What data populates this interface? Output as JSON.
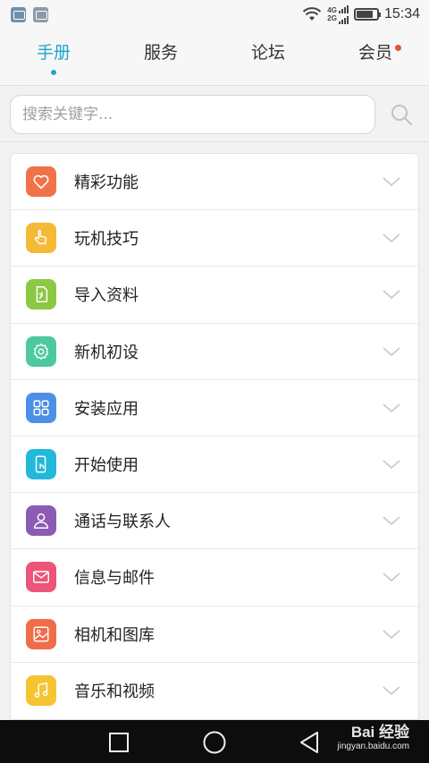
{
  "status_bar": {
    "time": "15:34",
    "network_top": "4G",
    "network_bottom": "2G"
  },
  "tabs": [
    {
      "label": "手册",
      "active": true
    },
    {
      "label": "服务",
      "active": false
    },
    {
      "label": "论坛",
      "active": false
    },
    {
      "label": "会员",
      "active": false,
      "badge": true
    }
  ],
  "search": {
    "placeholder": "搜索关键字..."
  },
  "list": {
    "items": [
      {
        "label": "精彩功能",
        "icon": "heart-icon",
        "color": "#f07347"
      },
      {
        "label": "玩机技巧",
        "icon": "hand-icon",
        "color": "#f5b935"
      },
      {
        "label": "导入资料",
        "icon": "import-file-icon",
        "color": "#8bc843"
      },
      {
        "label": "新机初设",
        "icon": "gear-icon",
        "color": "#4ec8a0"
      },
      {
        "label": "安装应用",
        "icon": "grid-icon",
        "color": "#4d8fe6"
      },
      {
        "label": "开始使用",
        "icon": "phone-touch-icon",
        "color": "#23b8d9"
      },
      {
        "label": "通话与联系人",
        "icon": "person-icon",
        "color": "#8c5bb3"
      },
      {
        "label": "信息与邮件",
        "icon": "mail-icon",
        "color": "#ec5478"
      },
      {
        "label": "相机和图库",
        "icon": "picture-icon",
        "color": "#f06d4a"
      },
      {
        "label": "音乐和视频",
        "icon": "music-icon",
        "color": "#f5c430"
      }
    ]
  },
  "watermark": {
    "main": "Bai 经验",
    "sub": "jingyan.baidu.com"
  },
  "colors": {
    "accent": "#1fa5c9",
    "badge": "#e8522e"
  }
}
